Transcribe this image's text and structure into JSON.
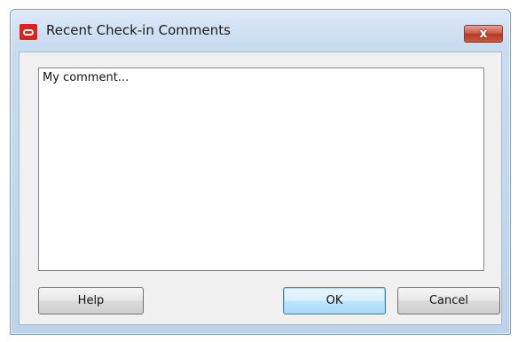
{
  "window": {
    "title": "Recent Check-in Comments",
    "logo_icon": "oracle-logo-icon",
    "close_label": "x",
    "close_icon": "close-icon",
    "close_color": "#c9533d"
  },
  "comment": {
    "value": "My comment..."
  },
  "buttons": {
    "help_label": "Help",
    "ok_label": "OK",
    "cancel_label": "Cancel"
  }
}
